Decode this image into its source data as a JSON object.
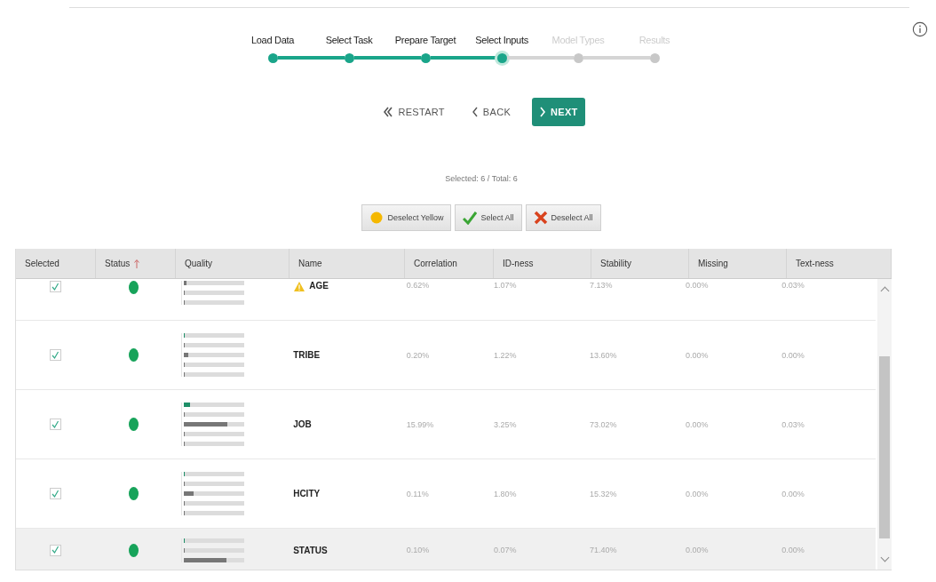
{
  "steps": [
    {
      "label": "Load Data",
      "done": true,
      "current": false
    },
    {
      "label": "Select Task",
      "done": true,
      "current": false
    },
    {
      "label": "Prepare Target",
      "done": true,
      "current": false
    },
    {
      "label": "Select Inputs",
      "done": true,
      "current": true
    },
    {
      "label": "Model Types",
      "done": false,
      "current": false
    },
    {
      "label": "Results",
      "done": false,
      "current": false
    }
  ],
  "nav_buttons": [
    {
      "label": "RESTART",
      "kind": "restart"
    },
    {
      "label": "BACK",
      "kind": "back"
    },
    {
      "label": "NEXT",
      "kind": "next"
    }
  ],
  "selection_summary": "Selected: 6 / Total: 6",
  "actions": [
    {
      "label": "Deselect Yellow",
      "kind": "yellow"
    },
    {
      "label": "Select All",
      "kind": "check"
    },
    {
      "label": "Deselect All",
      "kind": "cross"
    }
  ],
  "table": {
    "columns": [
      {
        "label": "Selected",
        "sorted": false
      },
      {
        "label": "Status",
        "sorted": true
      },
      {
        "label": "Quality",
        "sorted": false
      },
      {
        "label": "Name",
        "sorted": false
      },
      {
        "label": "Correlation",
        "sorted": false
      },
      {
        "label": "ID-ness",
        "sorted": false
      },
      {
        "label": "Stability",
        "sorted": false
      },
      {
        "label": "Missing",
        "sorted": false
      },
      {
        "label": "Text-ness",
        "sorted": false
      }
    ],
    "rows": [
      {
        "checked": true,
        "color": "#17a35a",
        "quality": [
          {
            "level": 0.03
          },
          {
            "level": 0
          },
          {
            "level": 0
          }
        ],
        "name": "AGE",
        "warning": true,
        "values": [
          "0.62%",
          "1.07%",
          "7.13%",
          "0.00%",
          "0.03%"
        ],
        "selected": false
      },
      {
        "checked": true,
        "color": "#17a35a",
        "quality": [
          {
            "level": 0
          },
          {
            "level": 0
          },
          {
            "level": 0.06
          },
          {
            "level": 0
          },
          {
            "level": 0
          }
        ],
        "name": "TRIBE",
        "warning": false,
        "values": [
          "0.20%",
          "1.22%",
          "13.60%",
          "0.00%",
          "0.00%"
        ],
        "selected": false
      },
      {
        "checked": true,
        "color": "#17a35a",
        "quality": [
          {
            "level": 0.1
          },
          {
            "level": 0
          },
          {
            "level": 0.72
          },
          {
            "level": 0
          },
          {
            "level": 0
          }
        ],
        "name": "JOB",
        "warning": false,
        "values": [
          "15.99%",
          "3.25%",
          "73.02%",
          "0.00%",
          "0.03%"
        ],
        "selected": false
      },
      {
        "checked": true,
        "color": "#17a35a",
        "quality": [
          {
            "level": 0
          },
          {
            "level": 0.01
          },
          {
            "level": 0.16
          },
          {
            "level": 0
          },
          {
            "level": 0
          }
        ],
        "name": "HCITY",
        "warning": false,
        "values": [
          "0.11%",
          "1.80%",
          "15.32%",
          "0.00%",
          "0.00%"
        ],
        "selected": false
      },
      {
        "checked": true,
        "color": "#17a35a",
        "quality": [
          {
            "level": 0
          },
          {
            "level": 0
          },
          {
            "level": 0.7
          }
        ],
        "name": "STATUS",
        "warning": false,
        "values": [
          "0.10%",
          "0.07%",
          "71.40%",
          "0.00%",
          "0.00%"
        ],
        "selected": true
      }
    ]
  }
}
